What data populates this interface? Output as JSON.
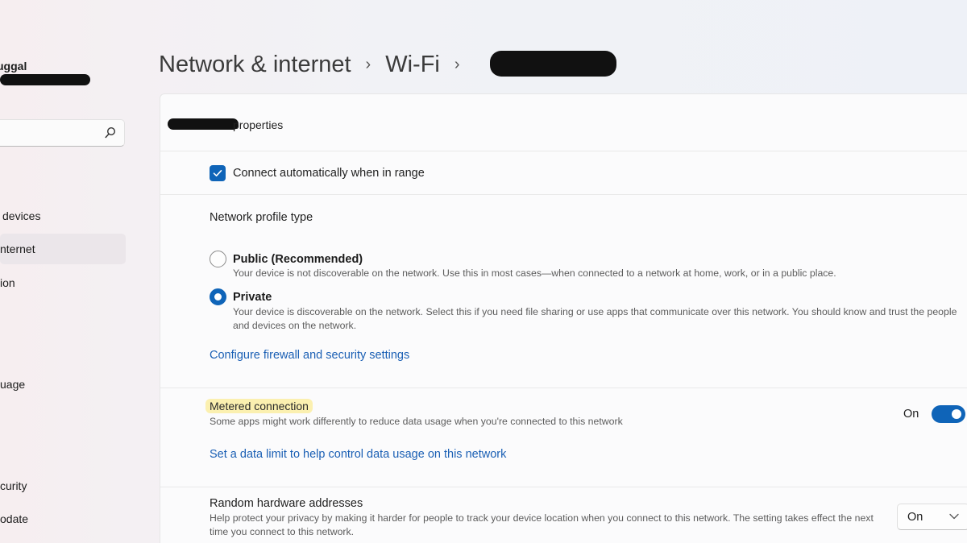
{
  "sidebar": {
    "user_name": "uggal",
    "search": {
      "value": "",
      "placeholder": ""
    },
    "items": [
      {
        "label": "devices",
        "selected": false
      },
      {
        "label": "nternet",
        "selected": true
      },
      {
        "label": "ion",
        "selected": false
      },
      {
        "label": "uage",
        "selected": false
      },
      {
        "label": "curity",
        "selected": false
      },
      {
        "label": "odate",
        "selected": false
      }
    ]
  },
  "header": {
    "breadcrumb": [
      "Network & internet",
      "Wi-Fi"
    ]
  },
  "properties": {
    "title_suffix": "properties",
    "connect_auto": {
      "label": "Connect automatically when in range",
      "checked": true
    },
    "profile_type": {
      "label": "Network profile type",
      "options": [
        {
          "title": "Public (Recommended)",
          "desc": "Your device is not discoverable on the network. Use this in most cases—when connected to a network at home, work, or in a public place.",
          "selected": false
        },
        {
          "title": "Private",
          "desc": "Your device is discoverable on the network. Select this if you need file sharing or use apps that communicate over this network. You should know and trust the people and devices on the network.",
          "selected": true
        }
      ]
    },
    "firewall_link": "Configure firewall and security settings",
    "metered": {
      "label": "Metered connection",
      "desc": "Some apps might work differently to reduce data usage when you're connected to this network",
      "state_label": "On",
      "enabled": true,
      "data_limit_link": "Set a data limit to help control data usage on this network"
    },
    "random_hw": {
      "label": "Random hardware addresses",
      "desc": "Help protect your privacy by making it harder for people to track your device location when you connect to this network. The setting takes effect the next time you connect to this network.",
      "value": "On"
    }
  },
  "colors": {
    "accent": "#0f64b8",
    "link": "#1a5fb4",
    "highlight": "#fbf0b0"
  },
  "icons": [
    "search-icon",
    "chevron-right-icon",
    "checkmark-icon",
    "chevron-down-icon"
  ]
}
